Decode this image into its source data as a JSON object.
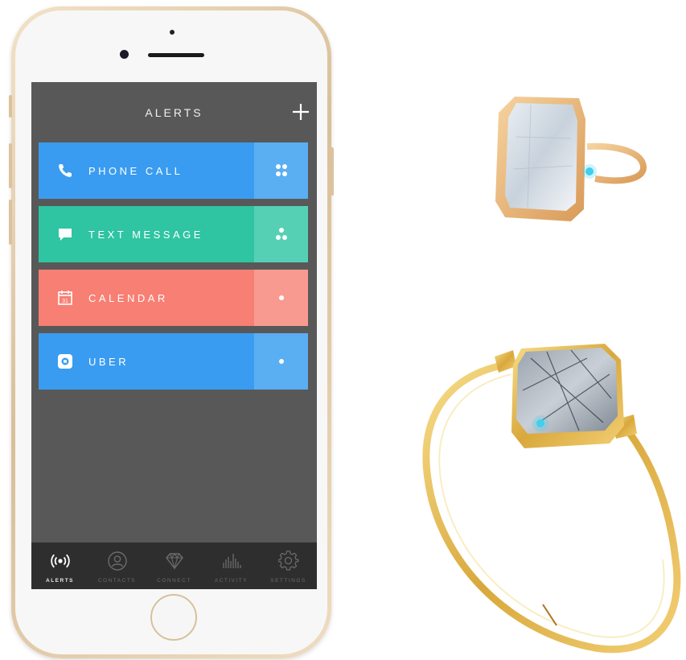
{
  "app": {
    "title": "ALERTS",
    "add_icon": "plus-icon"
  },
  "alerts": [
    {
      "label": "PHONE CALL",
      "icon": "phone-icon",
      "color": "#3a9cf0",
      "side_color": "#5aaef2",
      "dots": 4
    },
    {
      "label": "TEXT MESSAGE",
      "icon": "chat-bubble-icon",
      "color": "#2fc4a2",
      "side_color": "#55d0b4",
      "dots": 3
    },
    {
      "label": "CALENDAR",
      "icon": "calendar-icon",
      "color": "#f77f74",
      "side_color": "#f99a90",
      "dots": 1
    },
    {
      "label": "UBER",
      "icon": "uber-icon",
      "color": "#3a9cf0",
      "side_color": "#5aaef2",
      "dots": 1
    }
  ],
  "calendar_icon_day": "31",
  "tabs": [
    {
      "label": "ALERTS",
      "icon": "broadcast-icon",
      "active": true
    },
    {
      "label": "CONTACTS",
      "icon": "contact-icon",
      "active": false
    },
    {
      "label": "CONNECT",
      "icon": "diamond-icon",
      "active": false
    },
    {
      "label": "ACTIVITY",
      "icon": "activity-bars-icon",
      "active": false
    },
    {
      "label": "SETTINGS",
      "icon": "gear-icon",
      "active": false
    }
  ],
  "colors": {
    "screen_bg": "#585858",
    "tabbar_bg": "#2e2e2e",
    "gold": "#d9ad4a",
    "led": "#3fd0f0"
  }
}
